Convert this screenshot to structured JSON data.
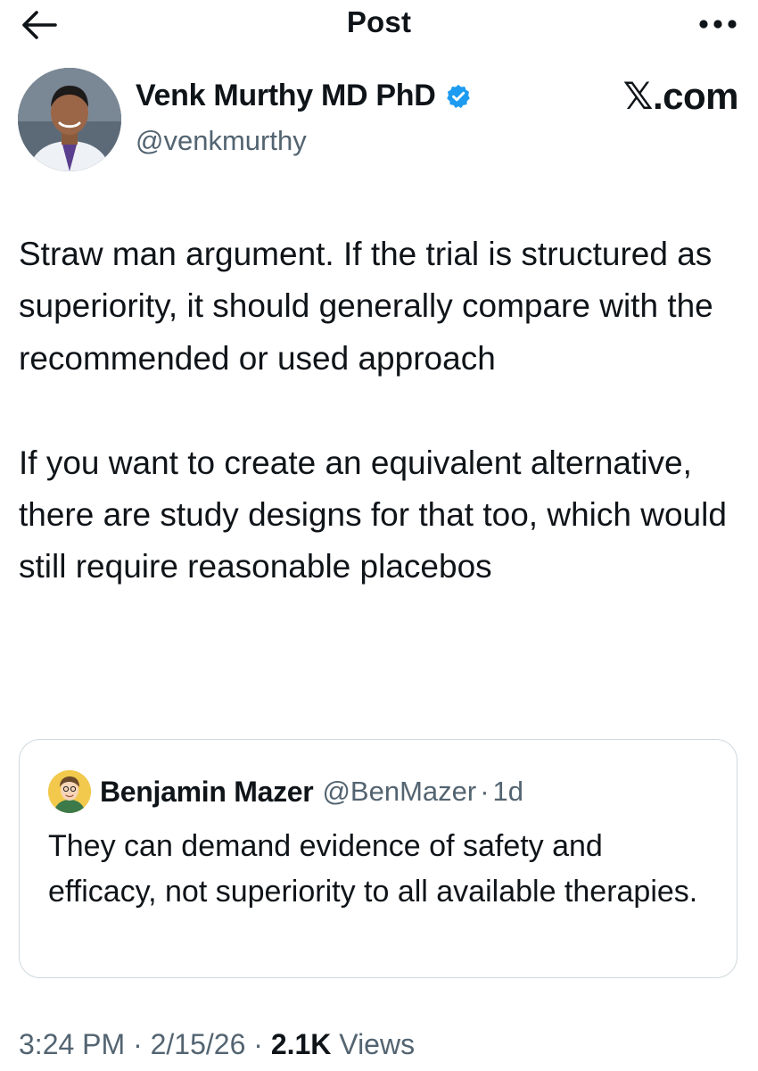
{
  "header": {
    "title": "Post",
    "back_icon": "arrow-left-icon",
    "more_icon": "more-horizontal-icon"
  },
  "author": {
    "name": "Venk Murthy MD PhD",
    "handle": "@venkmurthy",
    "verified_icon": "verified-badge-icon",
    "verified_color": "#1d9bf0"
  },
  "source_label": "𝕏.com",
  "post": {
    "paragraphs": [
      "Straw man argument. If the trial is structured as superiority, it should generally compare with the recommended or used approach",
      "If you want to create an equivalent alternative, there are study designs for that too, which would still require reasonable placebos"
    ]
  },
  "quote": {
    "name": "Benjamin Mazer",
    "handle": "@BenMazer",
    "separator": "·",
    "time": "1d",
    "text": "They can demand evidence of safety and efficacy, not superiority to all available therapies."
  },
  "meta": {
    "time": "3:24 PM",
    "date": "2/15/26",
    "separator": "·",
    "views_count": "2.1K",
    "views_label": "Views"
  },
  "colors": {
    "text_primary": "#0f1419",
    "text_secondary": "#536471",
    "border": "#cfd9de",
    "accent": "#1d9bf0"
  }
}
